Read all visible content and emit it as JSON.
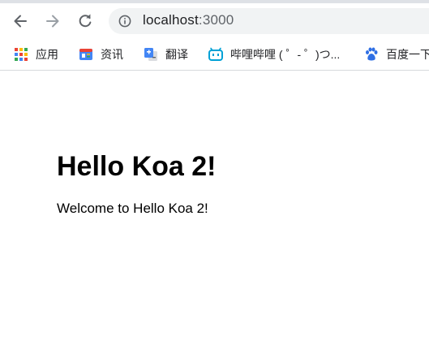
{
  "browser": {
    "url_host": "localhost",
    "url_port": ":3000",
    "icons": {
      "back": "arrow-left-icon",
      "forward": "arrow-right-icon",
      "reload": "reload-icon",
      "site_info": "info-icon"
    }
  },
  "bookmarks": [
    {
      "label": "应用",
      "icon": "apps-grid-icon"
    },
    {
      "label": "资讯",
      "icon": "news-icon"
    },
    {
      "label": "翻译",
      "icon": "translate-icon"
    },
    {
      "label": "哔哩哔哩 ( ゜- ゜)つ...",
      "icon": "bilibili-icon"
    },
    {
      "label": "百度一下",
      "icon": "baidu-paw-icon"
    }
  ],
  "page": {
    "heading": "Hello Koa 2!",
    "text": "Welcome to Hello Koa 2!"
  },
  "colors": {
    "omnibox_bg": "#f1f3f4",
    "icon_gray": "#5f6368",
    "disabled_gray": "#9aa0a6"
  }
}
